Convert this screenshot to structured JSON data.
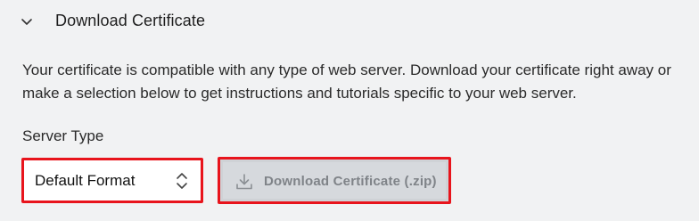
{
  "section": {
    "title": "Download Certificate",
    "expanded_icon": "chevron-down-icon"
  },
  "description": "Your certificate is compatible with any type of web server. Download your certificate right away or make a selection below to get instructions and tutorials specific to your web server.",
  "server_type": {
    "label": "Server Type",
    "selected": "Default Format",
    "icon": "select-arrows-icon"
  },
  "download_button": {
    "label": "Download Certificate (.zip)",
    "icon": "download-icon",
    "disabled": true
  },
  "colors": {
    "highlight_border": "#e8141c",
    "background": "#f1f2f3",
    "button_disabled_bg": "#d6d9dd",
    "button_disabled_text": "#7f8388"
  }
}
